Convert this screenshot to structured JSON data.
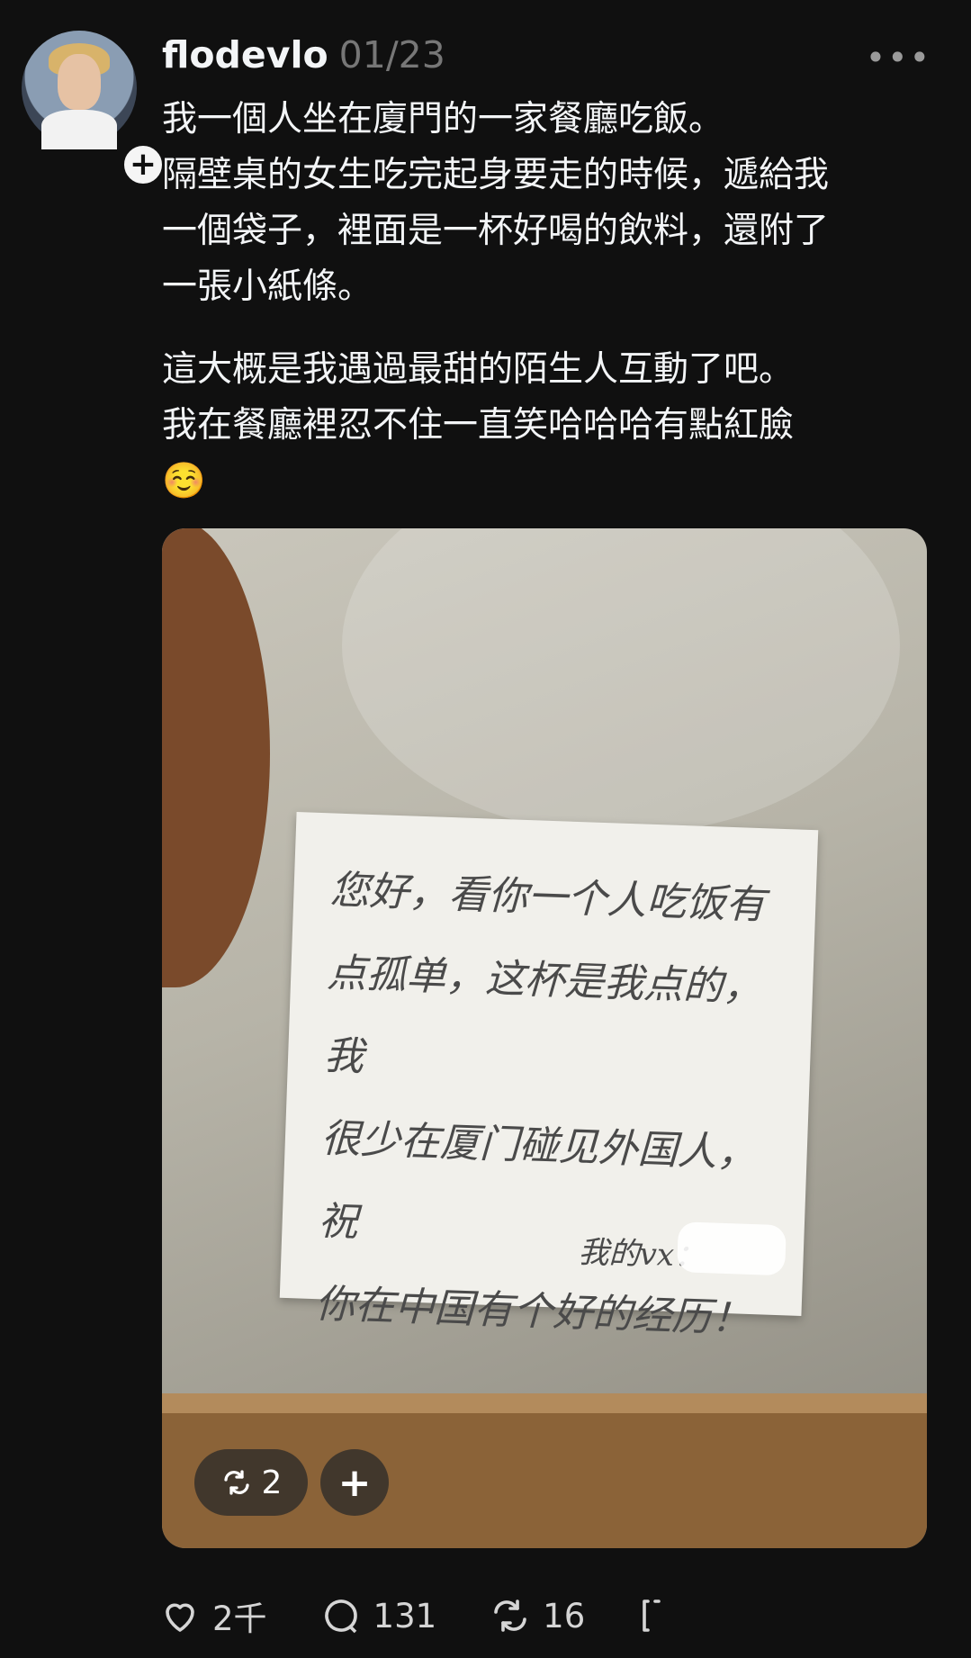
{
  "post": {
    "username": "flodevlo",
    "date": "01/23",
    "paragraph1": "我一個人坐在廈門的一家餐廳吃飯。\n隔壁桌的女生吃完起身要走的時候，遞給我\n一個袋子，裡面是一杯好喝的飲料，還附了\n一張小紙條。",
    "paragraph2": "這大概是我遇過最甜的陌生人互動了吧。\n我在餐廳裡忍不住一直笑哈哈哈有點紅臉\n☺️"
  },
  "note": {
    "text": "您好，看你一个人吃饭有\n点孤单，这杯是我点的，我\n很少在厦门碰见外国人，祝\n你在中国有个好的经历！",
    "signature": "我的vx："
  },
  "photo_overlay": {
    "repost_count": "2"
  },
  "actions": {
    "likes": "2千",
    "comments": "131",
    "reposts": "16"
  },
  "colors": {
    "background": "#101010",
    "text": "#f3f5f7",
    "muted": "#777777"
  }
}
